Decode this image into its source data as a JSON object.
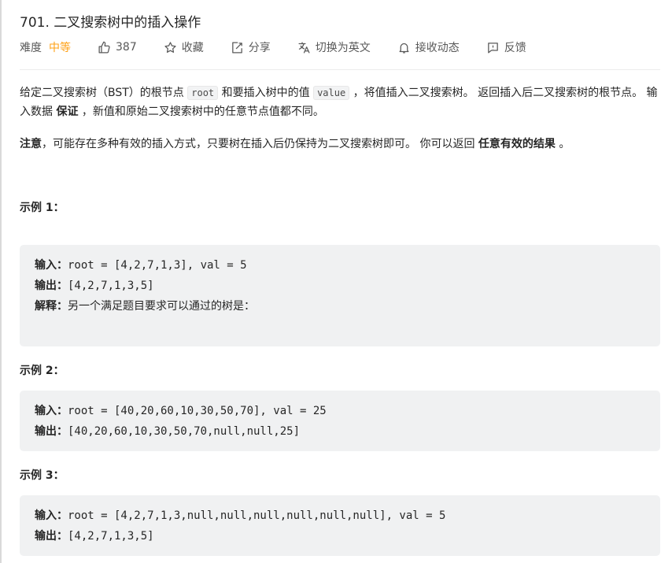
{
  "problem": {
    "title": "701. 二叉搜索树中的插入操作"
  },
  "meta": {
    "difficulty_label": "难度",
    "difficulty_value": "中等",
    "likes": "387",
    "favorite": "收藏",
    "share": "分享",
    "switch_language": "切换为英文",
    "notifications": "接收动态",
    "feedback": "反馈",
    "difficulty_color": "#ffa116"
  },
  "description": {
    "p1_a": "给定二叉搜索树（BST）的根节点 ",
    "p1_code1": "root",
    "p1_b": " 和要插入树中的值 ",
    "p1_code2": "value",
    "p1_c": " ，将值插入二叉搜索树。 返回插入后二叉搜索树的根节点。 输入数据 ",
    "p1_bold": "保证",
    "p1_d": " ，新值和原始二叉搜索树中的任意节点值都不同。",
    "p2_bold1": "注意",
    "p2_a": "，可能存在多种有效的插入方式，只要树在插入后仍保持为二叉搜索树即可。 你可以返回 ",
    "p2_bold2": "任意有效的结果",
    "p2_b": " 。"
  },
  "examples": [
    {
      "title": "示例 1：",
      "input_label": "输入：",
      "input": "root = [4,2,7,1,3], val = 5",
      "output_label": "输出：",
      "output": "[4,2,7,1,3,5]",
      "explanation_label": "解释：",
      "explanation": "另一个满足题目要求可以通过的树是："
    },
    {
      "title": "示例 2：",
      "input_label": "输入：",
      "input": "root = [40,20,60,10,30,50,70], val = 25",
      "output_label": "输出：",
      "output": "[40,20,60,10,30,50,70,null,null,25]"
    },
    {
      "title": "示例 3：",
      "input_label": "输入：",
      "input": "root = [4,2,7,1,3,null,null,null,null,null,null], val = 5",
      "output_label": "输出：",
      "output": "[4,2,7,1,3,5]"
    }
  ],
  "icons": [
    "thumbs-up-icon",
    "star-icon",
    "share-icon",
    "translate-icon",
    "bell-icon",
    "feedback-icon"
  ]
}
